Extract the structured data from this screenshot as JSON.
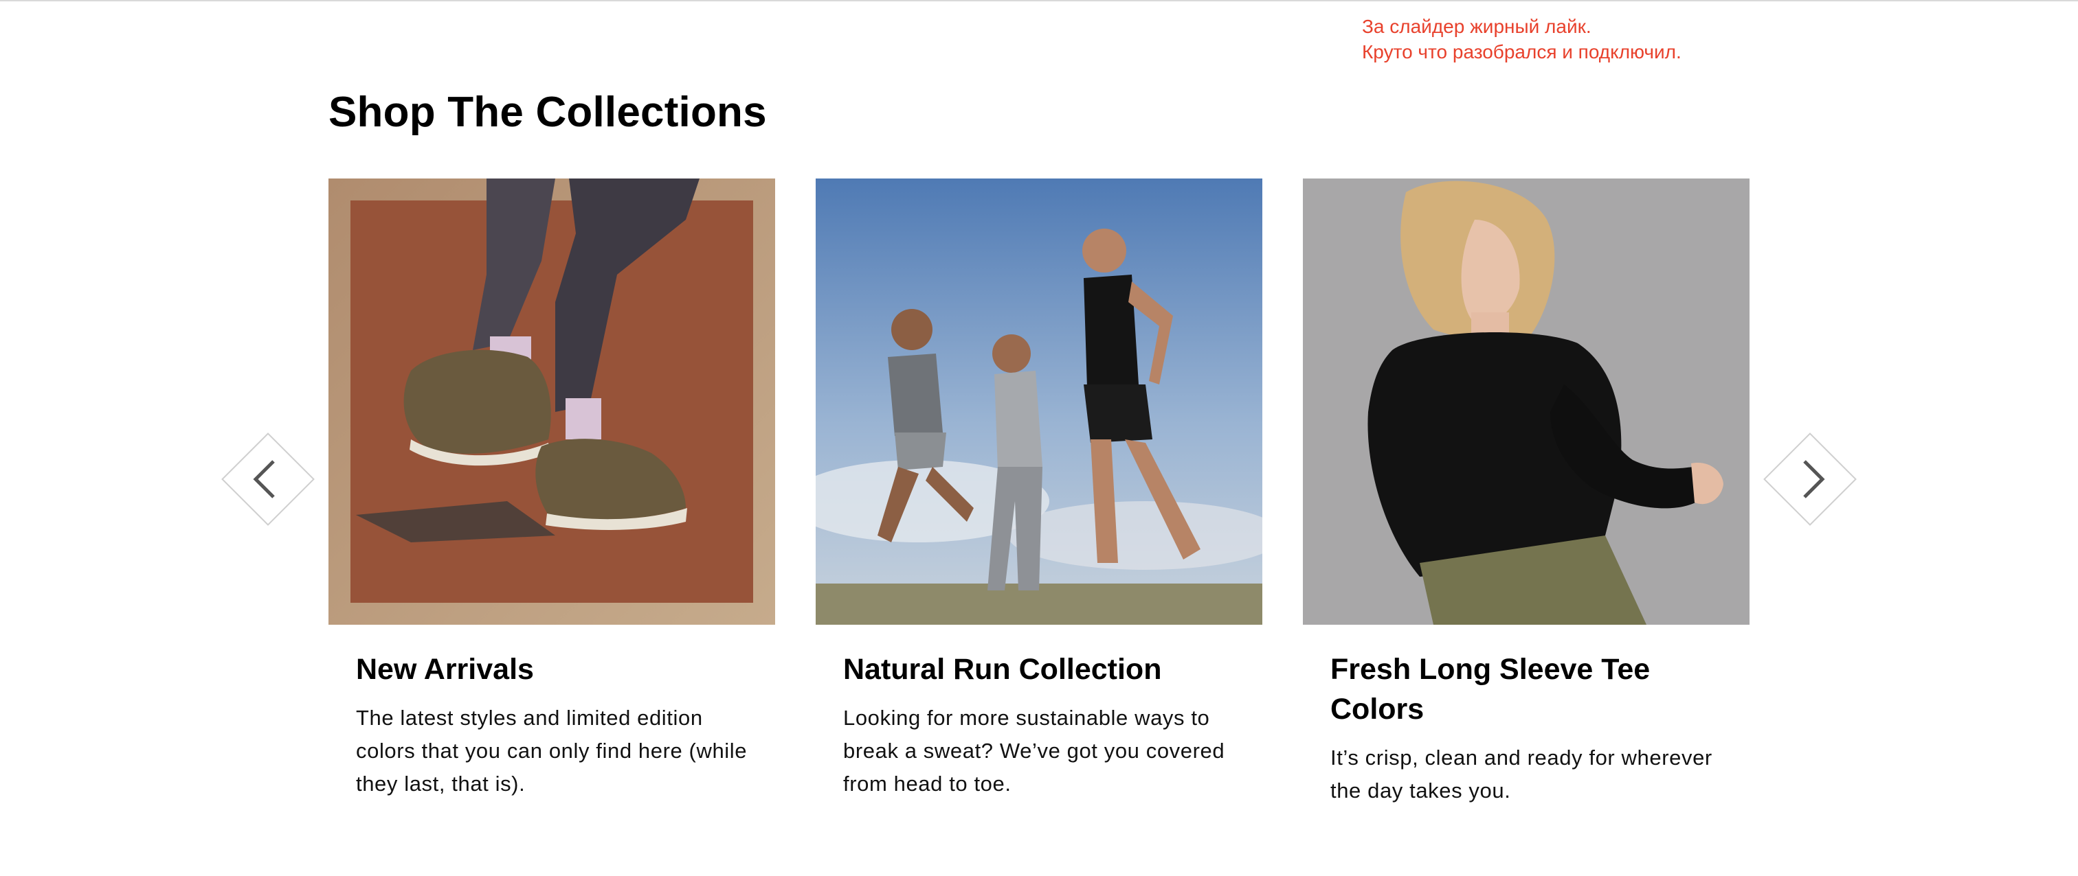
{
  "review_note": {
    "line1": "За слайдер жирный лайк.",
    "line2": "Круто что разобрался и подключил.",
    "color": "#e8412c"
  },
  "section": {
    "title": "Shop The Collections"
  },
  "carousel": {
    "prev_icon": "chevron-left-icon",
    "next_icon": "chevron-right-icon"
  },
  "cards": [
    {
      "title": "New Arrivals",
      "description": "The latest styles and limited edition colors that you can only find here (while they last, that is).",
      "image": "sneakers-photo"
    },
    {
      "title": "Natural Run Collection",
      "description": "Looking for more sustainable ways to break a sweat? We’ve got you covered from head to toe.",
      "image": "runners-photo"
    },
    {
      "title": "Fresh Long Sleeve Tee Colors",
      "description": "It’s crisp, clean and ready for wherever the day takes you.",
      "image": "long-sleeve-tee-photo"
    }
  ]
}
